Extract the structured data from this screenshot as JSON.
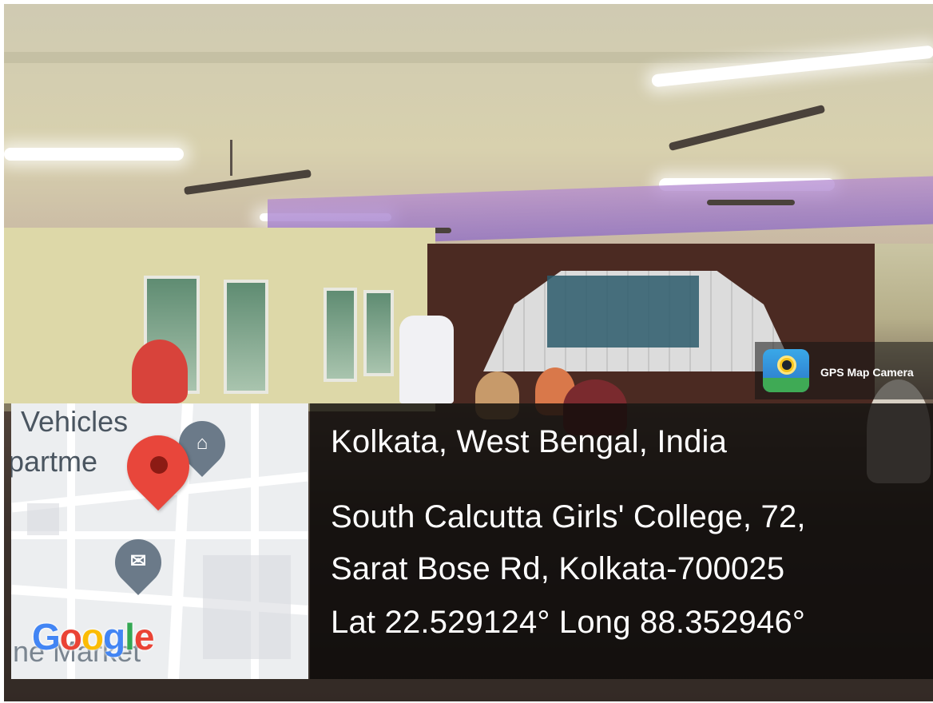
{
  "gps_app": {
    "name": "GPS Map Camera",
    "icon": "gps-map-camera-icon"
  },
  "location": {
    "city": "Kolkata, West Bengal, India",
    "address_line1": "South Calcutta Girls' College, 72,",
    "address_line2": "Sarat Bose Rd, Kolkata-700025",
    "coordinates": "Lat 22.529124° Long 88.352946°"
  },
  "map": {
    "label_top": "Vehicles",
    "label_mid": "partme",
    "label_bottom": "ne Market",
    "logo": [
      "G",
      "o",
      "o",
      "g",
      "l",
      "e"
    ],
    "marker_icon": "location-pin-icon",
    "poi_icons": [
      "museum-icon",
      "mail-icon"
    ]
  },
  "colors": {
    "marker": "#e8463b",
    "overlay": "#000000",
    "google_blue": "#4285f4",
    "google_red": "#ea4335",
    "google_yellow": "#fbbc05",
    "google_green": "#34a853"
  }
}
